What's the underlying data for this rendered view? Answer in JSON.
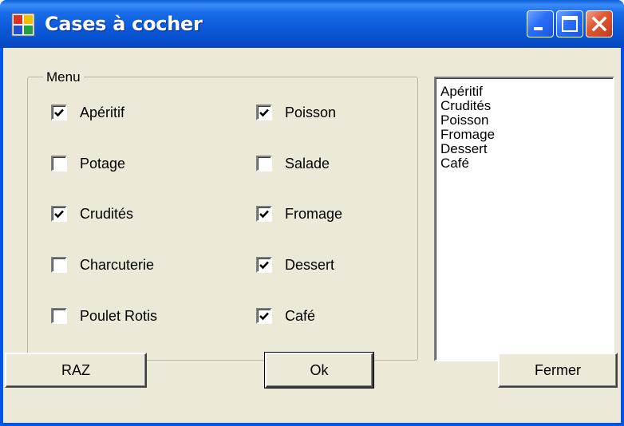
{
  "window": {
    "title": "Cases à cocher",
    "controls": [
      "minimize-icon",
      "maximize-icon",
      "close-icon"
    ]
  },
  "group": {
    "label": "Menu",
    "checkboxes": [
      {
        "label": "Apéritif",
        "checked": true
      },
      {
        "label": "Potage",
        "checked": false
      },
      {
        "label": "Crudités",
        "checked": true
      },
      {
        "label": "Charcuterie",
        "checked": false
      },
      {
        "label": "Poulet Rotis",
        "checked": false
      },
      {
        "label": "Poisson",
        "checked": true
      },
      {
        "label": "Salade",
        "checked": false
      },
      {
        "label": "Fromage",
        "checked": true
      },
      {
        "label": "Dessert",
        "checked": true
      },
      {
        "label": "Café",
        "checked": true
      }
    ]
  },
  "listbox": {
    "items": [
      "Apéritif",
      "Crudités",
      "Poisson",
      "Fromage",
      "Dessert",
      "Café"
    ]
  },
  "buttons": {
    "raz": "RAZ",
    "ok": "Ok",
    "close": "Fermer"
  },
  "colors": {
    "titlebar": "#0a5fd8",
    "client": "#ece9d8",
    "close_button": "#e05a35"
  }
}
